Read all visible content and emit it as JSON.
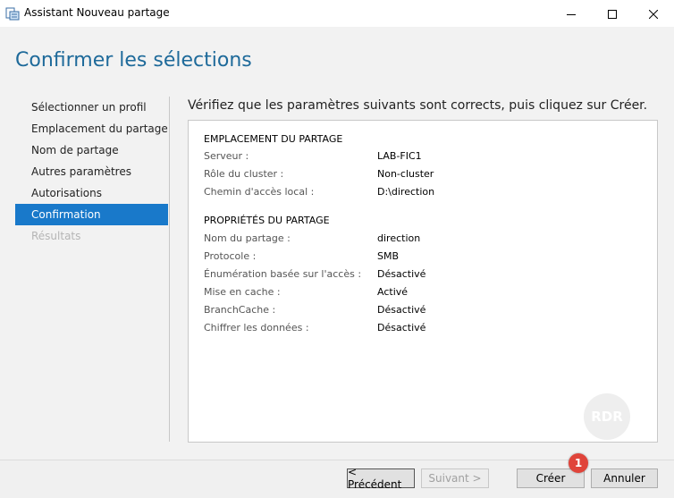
{
  "window": {
    "title": "Assistant Nouveau partage"
  },
  "page": {
    "title": "Confirmer les sélections",
    "instruction": "Vérifiez que les paramètres suivants sont corrects, puis cliquez sur Créer."
  },
  "nav": {
    "items": [
      {
        "label": "Sélectionner un profil",
        "state": "normal"
      },
      {
        "label": "Emplacement du partage",
        "state": "normal"
      },
      {
        "label": "Nom de partage",
        "state": "normal"
      },
      {
        "label": "Autres paramètres",
        "state": "normal"
      },
      {
        "label": "Autorisations",
        "state": "normal"
      },
      {
        "label": "Confirmation",
        "state": "active"
      },
      {
        "label": "Résultats",
        "state": "disabled"
      }
    ]
  },
  "summary": {
    "location": {
      "heading": "EMPLACEMENT DU PARTAGE",
      "rows": [
        {
          "label": "Serveur :",
          "value": "LAB-FIC1"
        },
        {
          "label": "Rôle du cluster :",
          "value": "Non-cluster"
        },
        {
          "label": "Chemin d'accès local :",
          "value": "D:\\direction"
        }
      ]
    },
    "properties": {
      "heading": "PROPRIÉTÉS DU PARTAGE",
      "rows": [
        {
          "label": "Nom du partage :",
          "value": "direction"
        },
        {
          "label": "Protocole :",
          "value": "SMB"
        },
        {
          "label": "Énumération basée sur l'accès :",
          "value": "Désactivé"
        },
        {
          "label": "Mise en cache :",
          "value": "Activé"
        },
        {
          "label": "BranchCache :",
          "value": "Désactivé"
        },
        {
          "label": "Chiffrer les données :",
          "value": "Désactivé"
        }
      ]
    }
  },
  "buttons": {
    "previous": "< Précédent",
    "next": "Suivant >",
    "create": "Créer",
    "cancel": "Annuler"
  },
  "badge": {
    "number": "1"
  },
  "watermark": {
    "text": "RDR"
  },
  "colors": {
    "title_blue": "#1e6a9a",
    "nav_active": "#1979ca",
    "badge_red": "#e0443a"
  }
}
